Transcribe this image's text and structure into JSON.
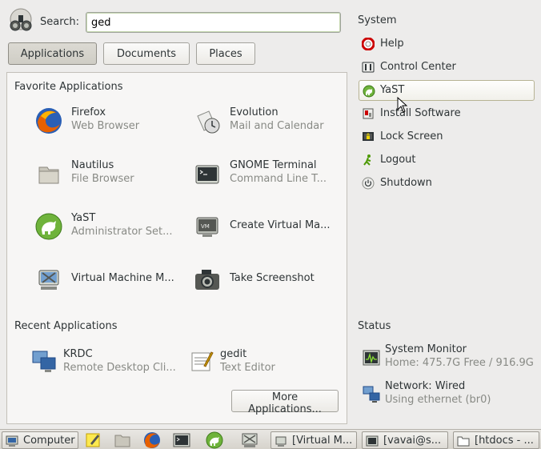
{
  "search": {
    "label": "Search:",
    "value": "ged"
  },
  "tabs": [
    {
      "label": "Applications",
      "active": true
    },
    {
      "label": "Documents",
      "active": false
    },
    {
      "label": "Places",
      "active": false
    }
  ],
  "favorites": {
    "title": "Favorite Applications",
    "items": [
      {
        "name": "Firefox",
        "sub": "Web Browser",
        "icon": "firefox-icon"
      },
      {
        "name": "Evolution",
        "sub": "Mail and Calendar",
        "icon": "evolution-icon"
      },
      {
        "name": "Nautilus",
        "sub": "File Browser",
        "icon": "folder-icon"
      },
      {
        "name": "GNOME Terminal",
        "sub": "Command Line T...",
        "icon": "terminal-icon"
      },
      {
        "name": "YaST",
        "sub": "Administrator Set...",
        "icon": "yast-icon"
      },
      {
        "name": "Create Virtual Ma...",
        "sub": "",
        "icon": "virtual-machine-create-icon"
      },
      {
        "name": "Virtual Machine M...",
        "sub": "",
        "icon": "virtual-machine-manager-icon"
      },
      {
        "name": "Take Screenshot",
        "sub": "",
        "icon": "camera-icon"
      }
    ]
  },
  "recent": {
    "title": "Recent Applications",
    "items": [
      {
        "name": "KRDC",
        "sub": "Remote Desktop Cli...",
        "icon": "remote-desktop-icon"
      },
      {
        "name": "gedit",
        "sub": "Text Editor",
        "icon": "text-editor-icon"
      }
    ]
  },
  "more_button": "More Applications...",
  "system": {
    "title": "System",
    "items": [
      {
        "label": "Help",
        "icon": "help-icon"
      },
      {
        "label": "Control Center",
        "icon": "control-center-icon"
      },
      {
        "label": "YaST",
        "icon": "yast-icon",
        "selected": true
      },
      {
        "label": "Install Software",
        "icon": "install-software-icon"
      },
      {
        "label": "Lock Screen",
        "icon": "lock-screen-icon"
      },
      {
        "label": "Logout",
        "icon": "logout-icon"
      },
      {
        "label": "Shutdown",
        "icon": "shutdown-icon"
      }
    ]
  },
  "status": {
    "title": "Status",
    "items": [
      {
        "name": "System Monitor",
        "sub": "Home: 475.7G Free / 916.9G",
        "icon": "system-monitor-icon"
      },
      {
        "name": "Network: Wired",
        "sub": "Using ethernet (br0)",
        "icon": "network-wired-icon"
      }
    ]
  },
  "taskbar": {
    "computer_label": "Computer",
    "launchers": [
      "text-editor-icon",
      "folder-icon",
      "firefox-icon",
      "terminal-icon",
      "yast-icon",
      "virtual-machine-manager-icon"
    ],
    "windows": [
      {
        "label": "[Virtual M...",
        "icon": "virtual-machine-manager-icon"
      },
      {
        "label": "[vavai@s...",
        "icon": "terminal-icon"
      },
      {
        "label": "[htdocs - ...",
        "icon": "folder-icon"
      }
    ]
  },
  "colors": {
    "background": "#edeceb",
    "panel": "#f7f6f5",
    "secondary_text": "#888a85",
    "selection_border": "#b7b394"
  }
}
